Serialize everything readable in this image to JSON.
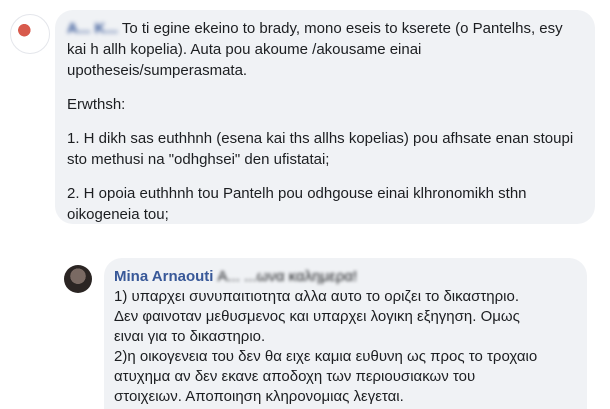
{
  "comment1": {
    "author": "A... K...",
    "intro": "To ti egine ekeino to brady, mono eseis to kserete (o Pantelhs, esy kai h allh kopelia). Auta pou akoume /akousame einai upotheseis/sumperasmata.",
    "question_label": "Erwthsh:",
    "q1": "1. H dikh sas euthhnh (esena kai ths allhs kopelias) pou afhsate enan stoupi sto methusi na \"odhghsei\" den ufistatai;",
    "q2": "2. H opoia euthhnh tou Pantelh pou odhgouse einai klhronomikh sthn oikogeneia tou;"
  },
  "comment2": {
    "author": "Mina Arnaouti",
    "greeting": "A... ...ωνα καλημερα!",
    "lines": [
      "1) υπαρχει συνυπαιτιοτητα αλλα αυτο το οριζει το δικαστηριο.",
      "Δεν φαινοταν μεθυσμενος και υπαρχει λογικη εξηγηση. Ομως",
      "ειναι για το δικαστηριο.",
      "2)η οικογενεια του δεν θα ειχε καμια ευθυνη ως προς το τροχαιο",
      "ατυχημα αν δεν εκανε αποδοχη των περιουσιακων του",
      "στοιχειων. Αποποιηση κληρονομιας λεγεται."
    ]
  }
}
